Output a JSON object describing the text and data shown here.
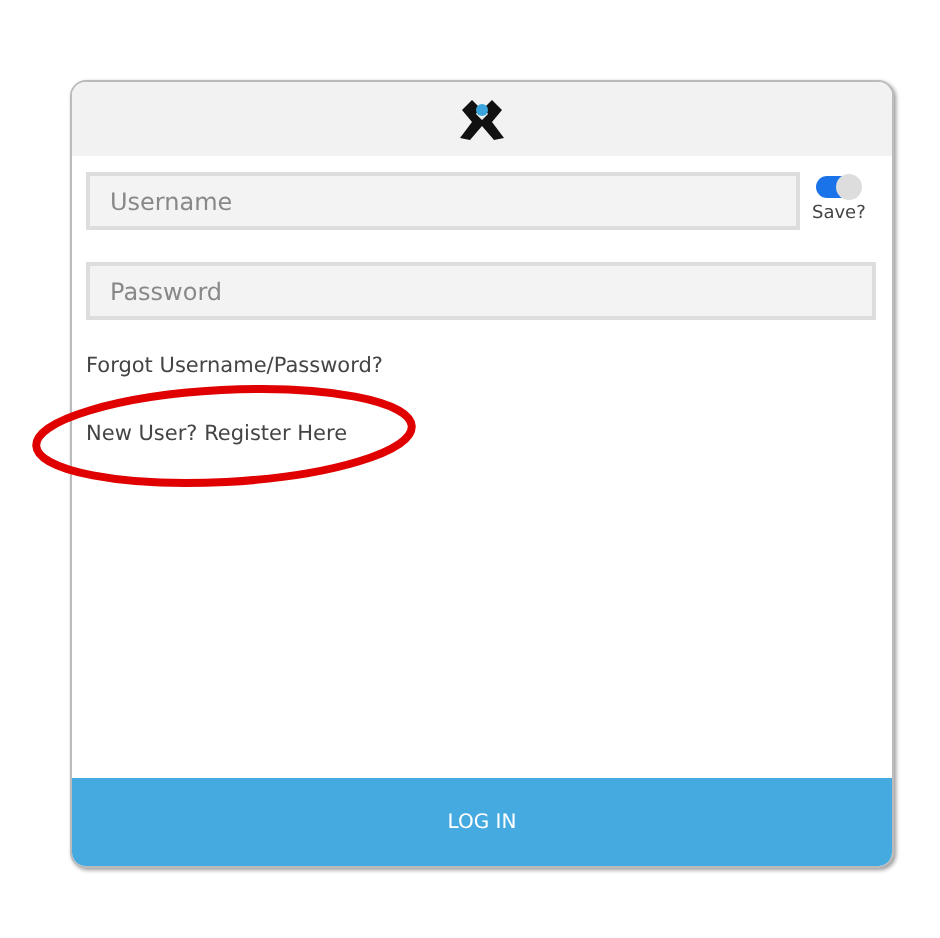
{
  "username": {
    "placeholder": "Username"
  },
  "save_toggle": {
    "label": "Save?",
    "on": true
  },
  "password": {
    "placeholder": "Password"
  },
  "links": [
    "Forgot Username/Password?",
    "New User? Register Here"
  ],
  "annotation": {
    "kind": "ellipse",
    "color": "#e00000"
  },
  "login_button": "LOG IN"
}
